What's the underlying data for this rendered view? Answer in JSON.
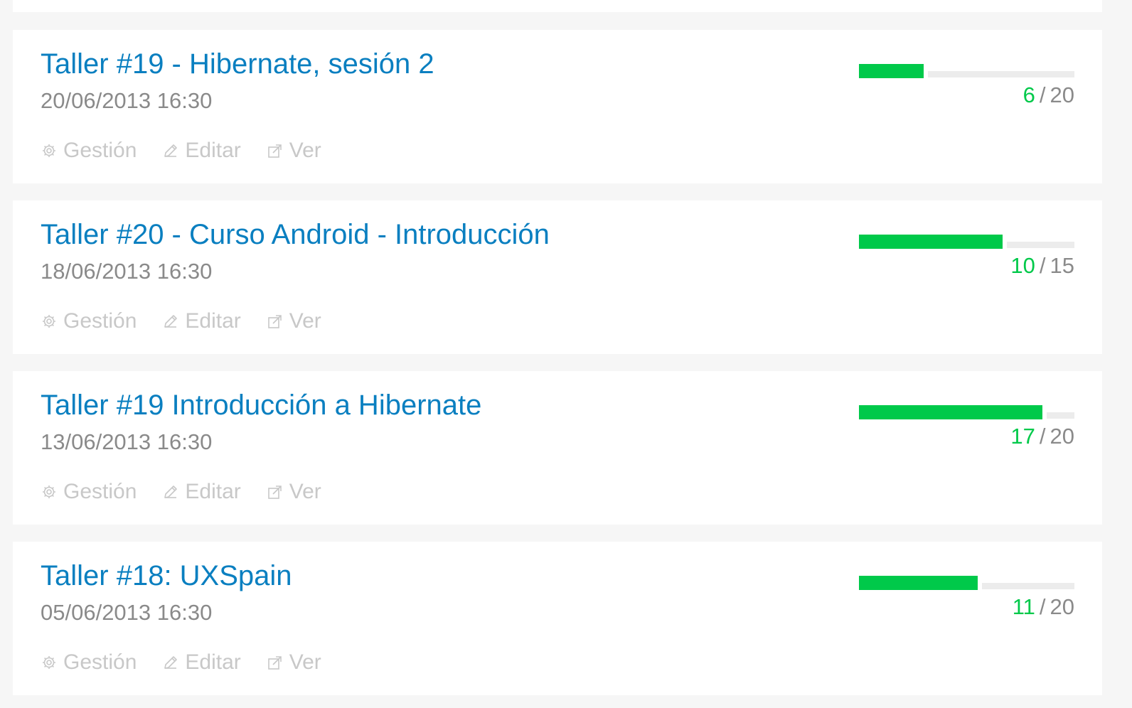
{
  "events": [
    {
      "title": "Taller #19 - Hibernate, sesión 2",
      "date": "20/06/2013 16:30",
      "attendees": "6",
      "capacity": "20",
      "actions": {
        "manage": "Gestión",
        "edit": "Editar",
        "view": "Ver"
      }
    },
    {
      "title": "Taller #20 - Curso Android - Introducción",
      "date": "18/06/2013 16:30",
      "attendees": "10",
      "capacity": "15",
      "actions": {
        "manage": "Gestión",
        "edit": "Editar",
        "view": "Ver"
      }
    },
    {
      "title": "Taller #19 Introducción a Hibernate",
      "date": "13/06/2013 16:30",
      "attendees": "17",
      "capacity": "20",
      "actions": {
        "manage": "Gestión",
        "edit": "Editar",
        "view": "Ver"
      }
    },
    {
      "title": "Taller #18: UXSpain",
      "date": "05/06/2013 16:30",
      "attendees": "11",
      "capacity": "20",
      "actions": {
        "manage": "Gestión",
        "edit": "Editar",
        "view": "Ver"
      }
    }
  ],
  "separator": "/",
  "icons": {
    "manage": "gear-icon",
    "edit": "pencil-icon",
    "view": "external-link-icon"
  },
  "colors": {
    "title": "#0a7fc0",
    "date": "#8a8a8a",
    "action": "#c8c8c8",
    "progress_fill": "#00c94a",
    "progress_track": "#ececec",
    "page_background": "#f6f6f6",
    "card_background": "#ffffff"
  }
}
